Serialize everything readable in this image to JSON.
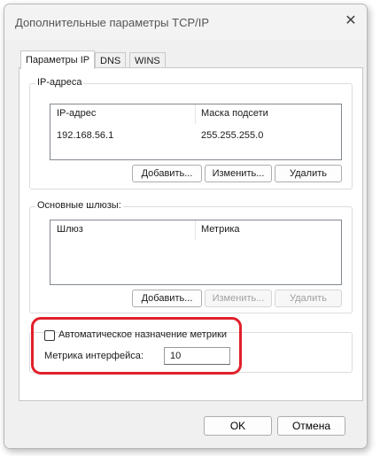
{
  "window": {
    "title": "Дополнительные параметры TCP/IP"
  },
  "tabs": [
    {
      "label": "Параметры IP",
      "active": true
    },
    {
      "label": "DNS",
      "active": false
    },
    {
      "label": "WINS",
      "active": false
    }
  ],
  "ip_group": {
    "title": "IP-адреса",
    "columns": [
      "IP-адрес",
      "Маска подсети"
    ],
    "rows": [
      {
        "ip": "192.168.56.1",
        "mask": "255.255.255.0"
      }
    ],
    "buttons": {
      "add": "Добавить...",
      "edit": "Изменить...",
      "delete": "Удалить"
    }
  },
  "gateway_group": {
    "title": "Основные шлюзы:",
    "columns": [
      "Шлюз",
      "Метрика"
    ],
    "buttons": {
      "add": "Добавить...",
      "edit": "Изменить...",
      "delete": "Удалить"
    }
  },
  "metric": {
    "auto_label": "Автоматическое назначение метрики",
    "auto_checked": false,
    "interface_label": "Метрика интерфейса:",
    "interface_value": "10"
  },
  "footer": {
    "ok": "OK",
    "cancel": "Отмена"
  },
  "colors": {
    "highlight": "#e0202a"
  }
}
